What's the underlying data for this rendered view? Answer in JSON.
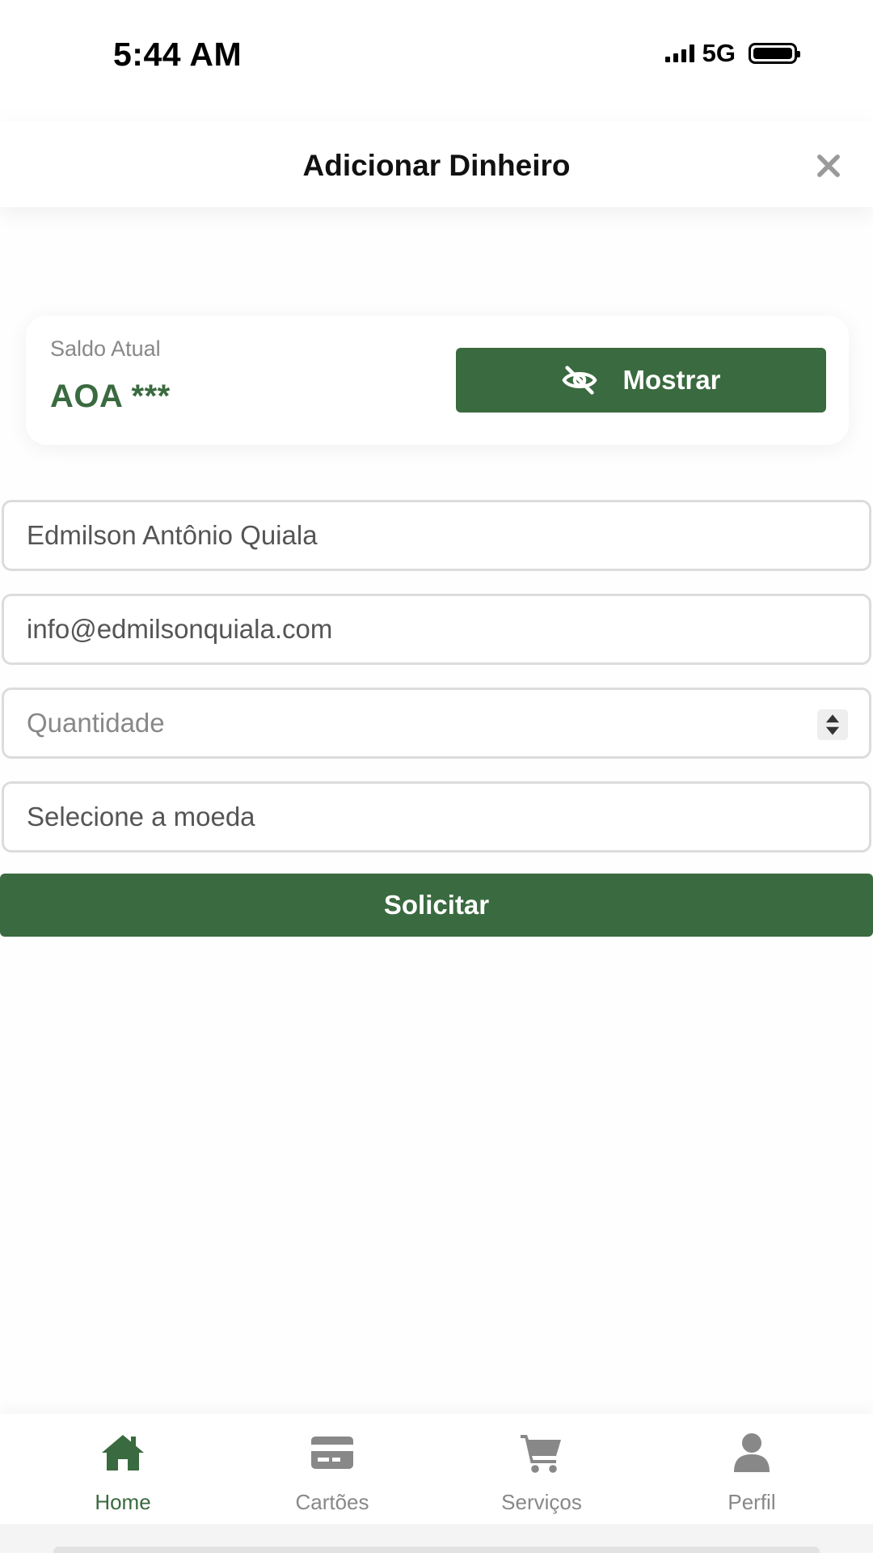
{
  "status_bar": {
    "time": "5:44 AM",
    "network": "5G",
    "battery_level": 1.0
  },
  "header": {
    "title": "Adicionar Dinheiro",
    "close_icon": "close-icon"
  },
  "balance": {
    "label": "Saldo Atual",
    "value": "AOA ***",
    "show_button_label": "Mostrar",
    "show_button_icon": "eye-slash-icon"
  },
  "form": {
    "name_value": "Edmilson Antônio Quiala",
    "email_value": "info@edmilsonquiala.com",
    "quantity_placeholder": "Quantidade",
    "currency_placeholder": "Selecione a moeda",
    "submit_label": "Solicitar"
  },
  "bottom_nav": {
    "items": [
      {
        "label": "Home",
        "icon": "home-icon",
        "active": true
      },
      {
        "label": "Cartões",
        "icon": "credit-card-icon",
        "active": false
      },
      {
        "label": "Serviços",
        "icon": "cart-icon",
        "active": false
      },
      {
        "label": "Perfil",
        "icon": "user-icon",
        "active": false
      }
    ]
  },
  "colors": {
    "accent": "#3a6a3f",
    "inactive": "#888888",
    "border": "#dcdcdc"
  }
}
